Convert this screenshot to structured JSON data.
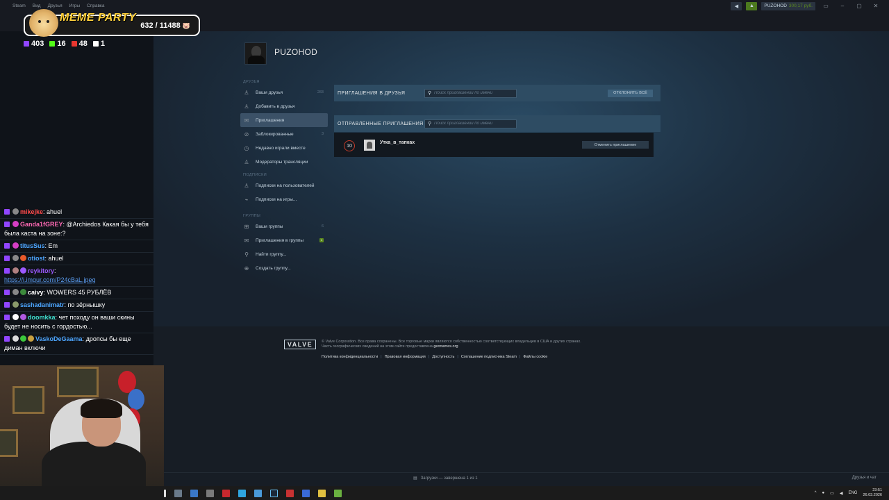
{
  "menubar": {
    "items": [
      "Steam",
      "Вид",
      "Друзья",
      "Игры",
      "Справка"
    ]
  },
  "account": {
    "name": "PUZOHOD",
    "balance": "300,17 руб."
  },
  "profile": {
    "username": "PUZOHOD"
  },
  "sidebar": {
    "friends_section": "ДРУЗЬЯ",
    "friends_items": [
      {
        "label": "Ваши друзья",
        "count": "283",
        "icon": "person-icon"
      },
      {
        "label": "Добавить в друзья",
        "count": "",
        "icon": "add-person-icon"
      },
      {
        "label": "Приглашения",
        "count": "",
        "icon": "envelope-icon"
      },
      {
        "label": "Заблокированные",
        "count": "3",
        "icon": "blocked-icon"
      },
      {
        "label": "Недавно играли вместе",
        "count": "",
        "icon": "clock-icon"
      },
      {
        "label": "Модераторы трансляции",
        "count": "",
        "icon": "moderator-icon"
      }
    ],
    "subs_section": "ПОДПИСКИ",
    "subs_items": [
      {
        "label": "Подписки на пользователей",
        "icon": "person-follow-icon"
      },
      {
        "label": "Подписки на игры...",
        "icon": "gamepad-icon"
      }
    ],
    "groups_section": "ГРУППЫ",
    "groups_items": [
      {
        "label": "Ваши группы",
        "count": "6",
        "icon": "group-icon"
      },
      {
        "label": "Приглашения в группы",
        "count": "1",
        "icon": "envelope-icon"
      },
      {
        "label": "Найти группу...",
        "count": "",
        "icon": "search-icon"
      },
      {
        "label": "Создать группу...",
        "count": "",
        "icon": "plus-circle-icon"
      }
    ]
  },
  "invites": {
    "title": "ПРИГЛАШЕНИЯ В ДРУЗЬЯ",
    "search_placeholder": "Поиск приглашений по имени",
    "reject_all": "ОТКЛОНИТЬ ВСЁ"
  },
  "sent": {
    "title": "ОТПРАВЛЕННЫЕ ПРИГЛАШЕНИЯ",
    "search_placeholder": "Поиск приглашений по имени",
    "friend": {
      "level": "10",
      "name": "Утка_в_тапках",
      "cancel": "Отменить приглашение"
    }
  },
  "footer": {
    "logo": "VALVE",
    "copyright_line1": "© Valve Corporation. Все права сохранены. Все торговые марки являются собственностью соответствующих владельцев в США и других странах.",
    "copyright_line2a": "Часть географических сведений на этом сайте предоставлена",
    "copyright_line2b": "geonames.org",
    "links": [
      "Политика конфиденциальности",
      "Правовая информация",
      "Доступность",
      "Соглашение подписчика Steam",
      "Файлы cookie"
    ]
  },
  "status": {
    "downloads": "Загрузки — завершена 1 из 1",
    "friends_chat": "Друзья и чат"
  },
  "taskbar": {
    "lang": "ENG",
    "time": "23:51",
    "date": "26.03.2026"
  },
  "overlay": {
    "badge_title": "MEME PARTY",
    "score": "632 / 11488",
    "stats": [
      {
        "value": "403",
        "color": "#9146ff"
      },
      {
        "value": "16",
        "color": "#53fc18"
      },
      {
        "value": "48",
        "color": "#e8362f"
      },
      {
        "value": "1",
        "color": "#ffffff"
      }
    ]
  },
  "chat": [
    {
      "user": "mikejke",
      "color": "#ff4a4a",
      "text": "ahuel"
    },
    {
      "user": "Ganda1fGREY",
      "color": "#ff69b4",
      "text": "@Archiedos Какая бы у тебя была каста на зоне:?"
    },
    {
      "user": "titusSus",
      "color": "#4da6ff",
      "text": "Em"
    },
    {
      "user": "otiost",
      "color": "#4da6ff",
      "text": "ahuel"
    },
    {
      "user": "reykitory",
      "color": "#9b59ff",
      "text": "",
      "link": "https://i.imgur.com/P24cBaL.jpeg"
    },
    {
      "user": "caivy",
      "color": "#ffffff",
      "text": "WOWERS 45 РУБЛЁВ"
    },
    {
      "user": "sashadanimatr",
      "color": "#4da6ff",
      "text": "по зёрнышку"
    },
    {
      "user": "doomkka",
      "color": "#40e0d0",
      "text": "чет походу он ваши скины будет не носить с гордостью..."
    },
    {
      "user": "VaskoDeGaama",
      "color": "#4da6ff",
      "text": "дропсы бы еще диман включи"
    }
  ]
}
